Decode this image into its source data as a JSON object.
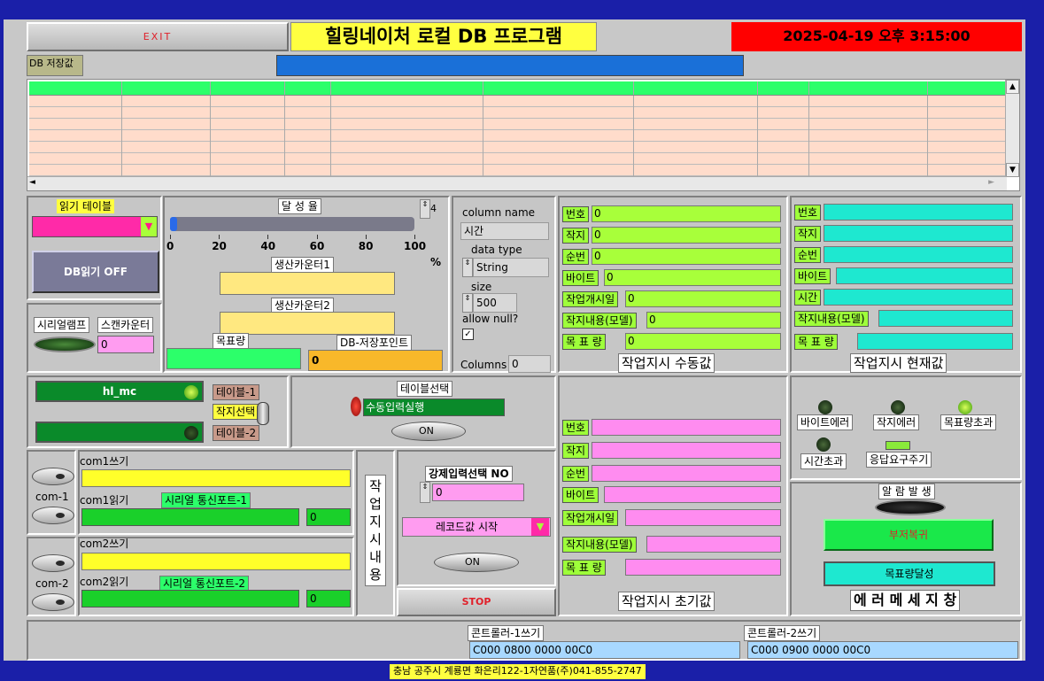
{
  "header": {
    "exit_label": "EXIT",
    "title": "힐링네이처 로컬 DB 프로그램",
    "datetime": "2025-04-19 오후 3:15:00",
    "db_save_label": "DB 저장값"
  },
  "table": {
    "rows": 7
  },
  "read_table": {
    "label": "읽기 테이블",
    "db_read_button": "DB읽기 OFF"
  },
  "serial_lamp": {
    "label": "시리얼램프",
    "scan_label": "스캔카운터",
    "scan_value": "0"
  },
  "achievement": {
    "label": "달 성 율",
    "value": 0,
    "scale": [
      "0",
      "20",
      "40",
      "60",
      "80",
      "100"
    ],
    "unit": "%",
    "stepper_value": "4",
    "counter1_label": "생산카운터1",
    "counter2_label": "생산카운터2",
    "target_label": "목표량",
    "db_point_label": "DB-저장포인트",
    "db_point_value": "0"
  },
  "column_props": {
    "column_name_label": "column name",
    "column_name_value": "시간",
    "data_type_label": "data type",
    "data_type_value": "String",
    "size_label": "size",
    "size_value": "500",
    "allow_null_label": "allow null?",
    "columns_label": "Columns",
    "columns_value": "0"
  },
  "manual": {
    "title": "작업지시 수동값",
    "fields": [
      {
        "label": "번호",
        "value": "0"
      },
      {
        "label": "작지",
        "value": "0"
      },
      {
        "label": "순번",
        "value": "0"
      },
      {
        "label": "바이트",
        "value": "0"
      },
      {
        "label": "작업개시일",
        "value": "0"
      },
      {
        "label": "작지내용(모델)",
        "value": "0"
      },
      {
        "label": "목 표 량",
        "value": "0"
      }
    ]
  },
  "current": {
    "title": "작업지시 현재값",
    "fields": [
      {
        "label": "번호"
      },
      {
        "label": "작지"
      },
      {
        "label": "순번"
      },
      {
        "label": "바이트"
      },
      {
        "label": "시간"
      },
      {
        "label": "작지내용(모델)"
      },
      {
        "label": "목 표 량"
      }
    ]
  },
  "initial": {
    "title": "작업지시 초기값",
    "fields": [
      {
        "label": "번호"
      },
      {
        "label": "작지"
      },
      {
        "label": "순번"
      },
      {
        "label": "바이트"
      },
      {
        "label": "작업개시일"
      },
      {
        "label": "작지내용(모델)"
      },
      {
        "label": "목 표 량"
      }
    ]
  },
  "table_select": {
    "hl_mc": "hl_mc",
    "table1": "테이블-1",
    "job_select": "작지선택",
    "table2": "테이블-2",
    "title": "테이블선택",
    "manual_exec": "수동입력실행",
    "on_label": "ON"
  },
  "com": {
    "com1_write": "com1쓰기",
    "com1_read": "com1읽기",
    "serial_port1": "시리얼 통신포트-1",
    "com1_value": "0",
    "com1_label": "com-1",
    "com2_write": "com2쓰기",
    "com2_read": "com2읽기",
    "serial_port2": "시리얼 통신포트-2",
    "com2_value": "0",
    "com2_label": "com-2",
    "work_content": [
      "작",
      "업",
      "지",
      "시",
      "내",
      "용"
    ]
  },
  "force_input": {
    "label": "강제입력선택 NO",
    "value": "0",
    "record_start": "레코드값 시작",
    "on_label": "ON",
    "stop": "STOP"
  },
  "errors": {
    "byte_error": "바이트에러",
    "job_error": "작지에러",
    "target_exceeded": "목표량초과",
    "timeout": "시간초과",
    "response_period": "응답요구주기",
    "alarm": "알 람 발 생",
    "buzzer_reset": "부저복귀",
    "target_reached": "목표량달성",
    "error_msg": "에 러 메 세 지 창"
  },
  "controller": {
    "c1_label": "콘트롤러-1쓰기",
    "c1_value": "C000 0800 0000 00C0",
    "c2_label": "콘트롤러-2쓰기",
    "c2_value": "C000 0900 0000 00C0"
  },
  "footer": {
    "address": "충남 공주시 계룡면 화은리122-1자연품(주)041-855-2747"
  },
  "colors": {
    "bg": "#1a1fa8",
    "title_yellow": "#ffff40",
    "datetime_red": "#ff0000",
    "table_row": "#ffdccb",
    "header_row": "#2cff6a"
  }
}
